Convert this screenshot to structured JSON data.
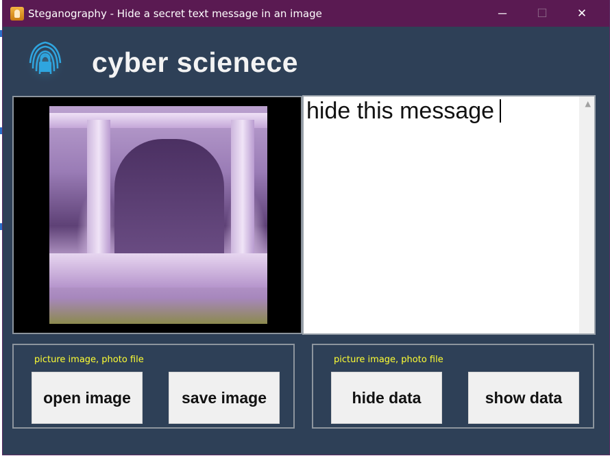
{
  "window": {
    "title": "Steganography - Hide a secret text message in an image",
    "controls": {
      "minimize": "─",
      "maximize": "☐",
      "close": "✕"
    }
  },
  "header": {
    "title": "cyber scienece",
    "logo_icon": "fingerprint-lock-icon"
  },
  "image_panel": {
    "has_image": true
  },
  "message": {
    "text": "hide this message"
  },
  "groups": [
    {
      "label": "picture image, photo file",
      "buttons": [
        {
          "label": "open image"
        },
        {
          "label": "save image"
        }
      ]
    },
    {
      "label": "picture image, photo file",
      "buttons": [
        {
          "label": "hide data"
        },
        {
          "label": "show data"
        }
      ]
    }
  ],
  "colors": {
    "titlebar": "#5a1a52",
    "window_bg": "#2e4057",
    "group_label": "#ffff33"
  }
}
